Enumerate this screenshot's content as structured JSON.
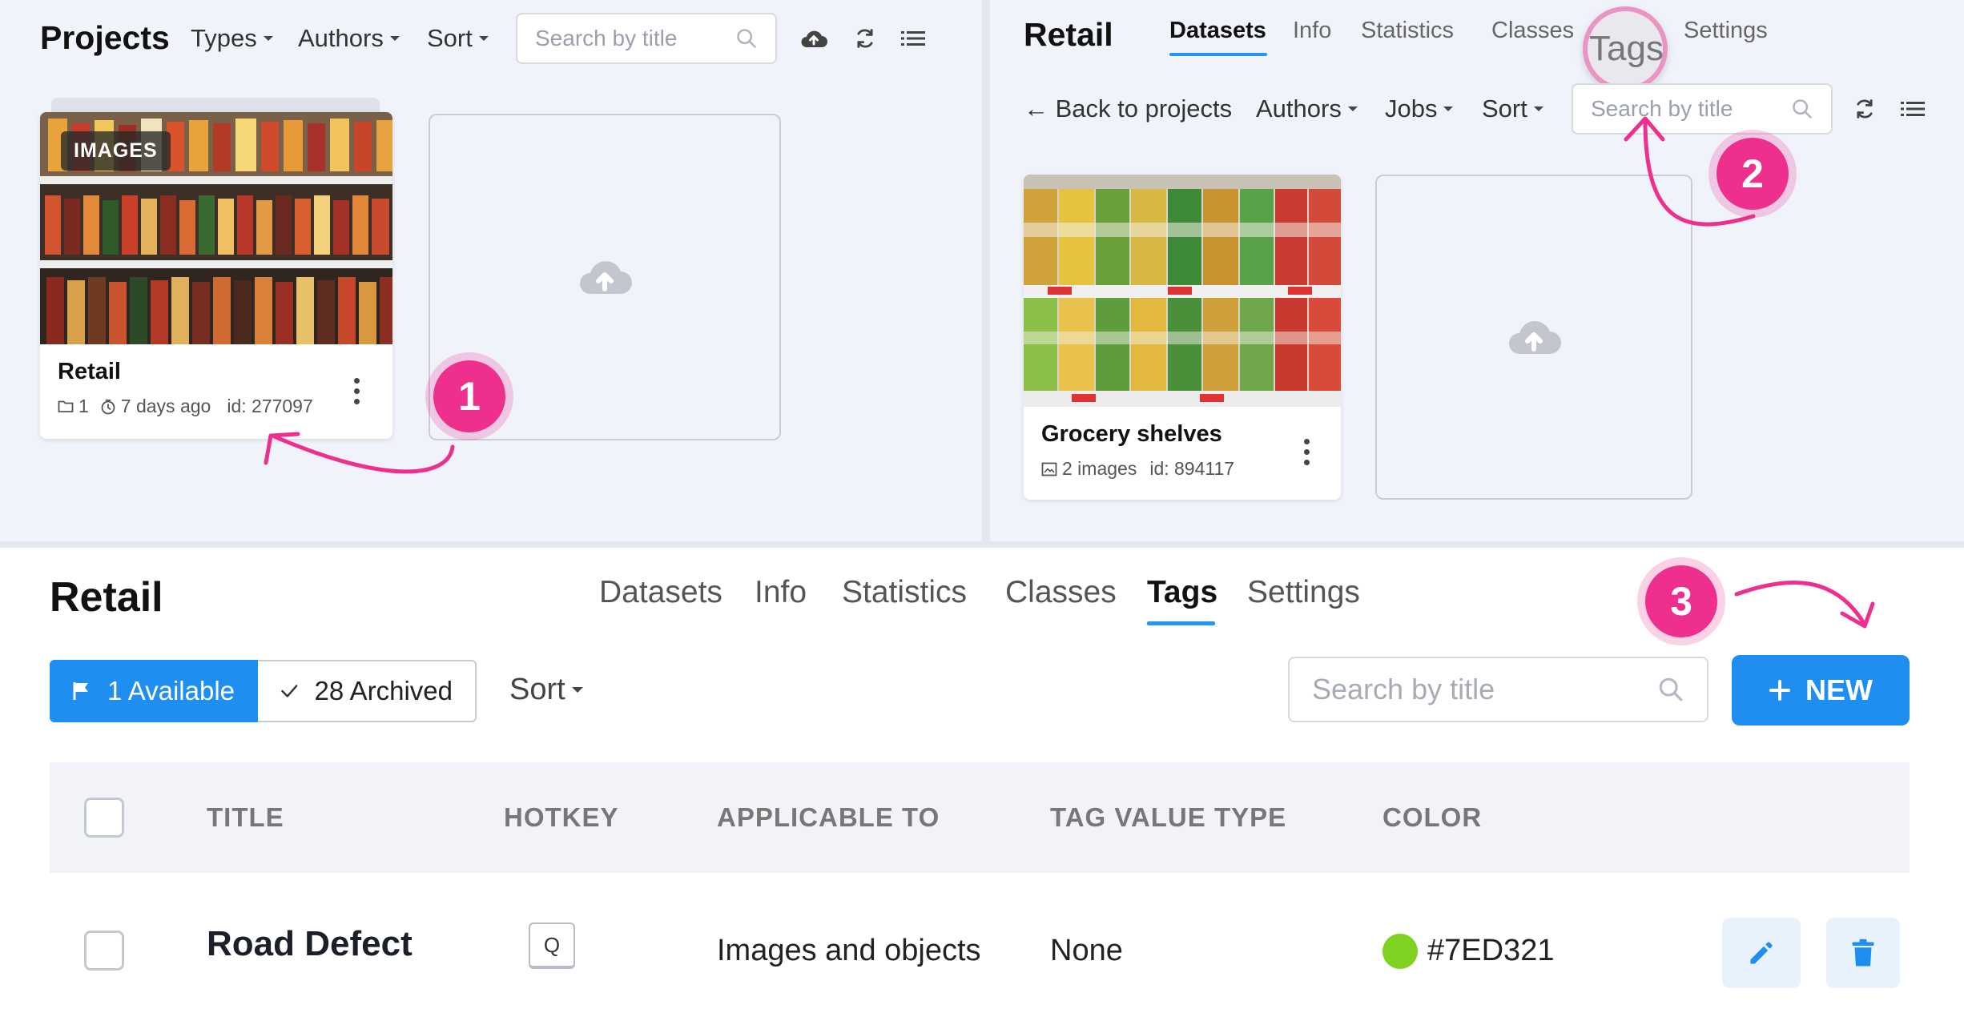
{
  "projects_panel": {
    "title": "Projects",
    "filters": [
      "Types",
      "Authors",
      "Sort"
    ],
    "search_placeholder": "Search by title",
    "project_card": {
      "badge": "IMAGES",
      "name": "Retail",
      "dataset_count": "1",
      "age": "7 days ago",
      "id_text": "id: 277097"
    }
  },
  "retail_panel": {
    "title": "Retail",
    "tabs": [
      "Datasets",
      "Info",
      "Statistics",
      "Classes",
      "Tags",
      "Settings"
    ],
    "active_tab": "Datasets",
    "back_link": "← Back to projects",
    "filters": [
      "Authors",
      "Jobs",
      "Sort"
    ],
    "search_placeholder": "Search by title",
    "dataset_card": {
      "name": "Grocery shelves",
      "image_count": "2 images",
      "id_text": "id: 894117"
    }
  },
  "steps": [
    "1",
    "2",
    "3"
  ],
  "tags_page": {
    "title": "Retail",
    "tabs": [
      "Datasets",
      "Info",
      "Statistics",
      "Classes",
      "Tags",
      "Settings"
    ],
    "active_tab": "Tags",
    "available_label": "1 Available",
    "archived_label": "28 Archived",
    "sort_label": "Sort",
    "search_placeholder": "Search by title",
    "new_button_label": "NEW",
    "table": {
      "headers": [
        "TITLE",
        "HOTKEY",
        "APPLICABLE TO",
        "TAG VALUE TYPE",
        "COLOR"
      ],
      "rows": [
        {
          "title": "Road Defect",
          "hotkey": "Q",
          "applicable_to": "Images and objects",
          "value_type": "None",
          "color": "#7ED321"
        }
      ]
    }
  },
  "colors": {
    "accent": "#2196F3",
    "step_badge": "#EE2F8E",
    "panel_bg": "#F1F3FB"
  }
}
